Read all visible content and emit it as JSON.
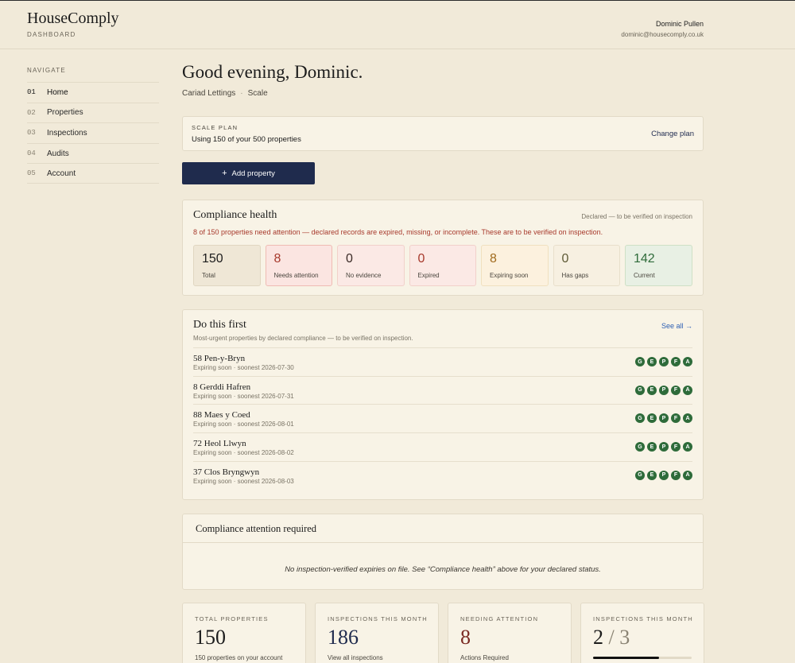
{
  "header": {
    "brand": "HouseComply",
    "brand_sub": "DASHBOARD",
    "user_name": "Dominic Pullen",
    "user_email": "dominic@housecomply.co.uk"
  },
  "sidebar": {
    "title": "NAVIGATE",
    "items": [
      {
        "num": "01",
        "label": "Home"
      },
      {
        "num": "02",
        "label": "Properties"
      },
      {
        "num": "03",
        "label": "Inspections"
      },
      {
        "num": "04",
        "label": "Audits"
      },
      {
        "num": "05",
        "label": "Account"
      }
    ]
  },
  "main": {
    "greeting": "Good evening, Dominic.",
    "org": "Cariad Lettings",
    "separator": "·",
    "tier": "Scale",
    "plan": {
      "kicker": "SCALE PLAN",
      "text": "Using 150 of your 500 properties",
      "change": "Change plan"
    },
    "add_button": {
      "icon": "+",
      "label": "Add property"
    },
    "health": {
      "title": "Compliance health",
      "note": "Declared — to be verified on inspection",
      "alert": "8 of 150 properties need attention — declared records are expired, missing, or incomplete. These are to be verified on inspection.",
      "stats": [
        {
          "value": "150",
          "label": "Total"
        },
        {
          "value": "8",
          "label": "Needs attention"
        },
        {
          "value": "0",
          "label": "No evidence"
        },
        {
          "value": "0",
          "label": "Expired"
        },
        {
          "value": "8",
          "label": "Expiring soon"
        },
        {
          "value": "0",
          "label": "Has gaps"
        },
        {
          "value": "142",
          "label": "Current"
        }
      ]
    },
    "do_first": {
      "title": "Do this first",
      "subtitle": "Most-urgent properties by declared compliance — to be verified on inspection.",
      "see_all": "See all →",
      "badges": [
        "G",
        "E",
        "P",
        "F",
        "A"
      ],
      "rows": [
        {
          "name": "58 Pen-y-Bryn",
          "meta": "Expiring soon · soonest 2026-07-30"
        },
        {
          "name": "8 Gerddi Hafren",
          "meta": "Expiring soon · soonest 2026-07-31"
        },
        {
          "name": "88 Maes y Coed",
          "meta": "Expiring soon · soonest 2026-08-01"
        },
        {
          "name": "72 Heol Llwyn",
          "meta": "Expiring soon · soonest 2026-08-02"
        },
        {
          "name": "37 Clos Bryngwyn",
          "meta": "Expiring soon · soonest 2026-08-03"
        }
      ]
    },
    "attention": {
      "title": "Compliance attention required",
      "message": "No inspection-verified expiries on file. See “Compliance health” above for your declared status."
    },
    "kpis": [
      {
        "label": "TOTAL PROPERTIES",
        "value": "150",
        "foot": "150 properties on your account"
      },
      {
        "label": "INSPECTIONS THIS MONTH",
        "value": "186",
        "foot": "View all inspections"
      },
      {
        "label": "NEEDING ATTENTION",
        "value": "8",
        "foot": "Actions Required"
      },
      {
        "label": "INSPECTIONS THIS MONTH",
        "value": "2",
        "slash": "/",
        "of": "3",
        "progress": 0.67
      }
    ]
  }
}
